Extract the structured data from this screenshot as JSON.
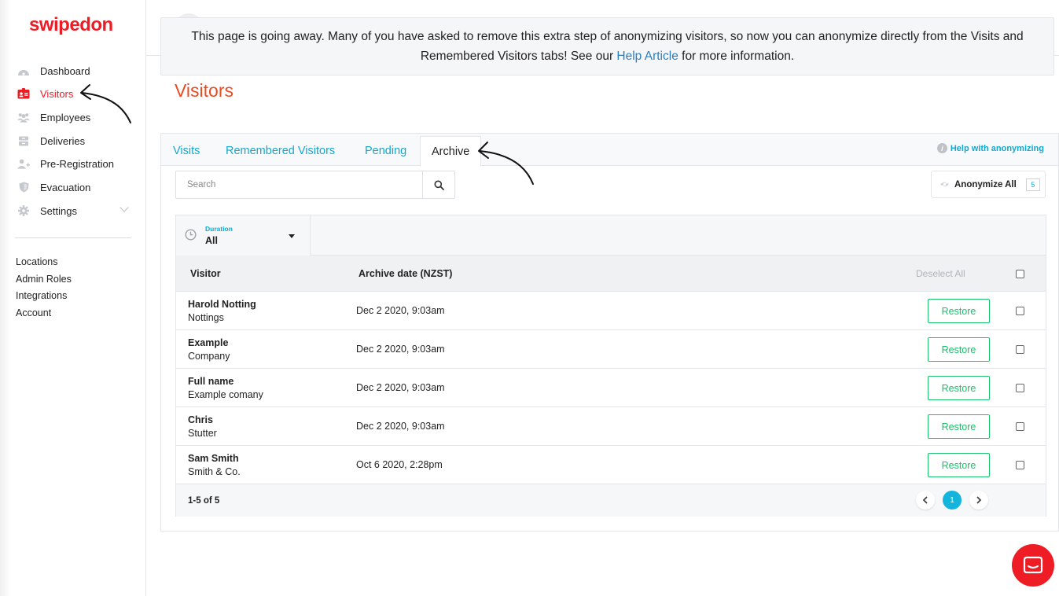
{
  "brand": {
    "logo_text": "swipedon",
    "brand_color": "#ee1c25"
  },
  "sidebar": {
    "items": [
      {
        "label": "Dashboard",
        "icon": "dashboard-icon",
        "active": false
      },
      {
        "label": "Visitors",
        "icon": "visitor-badge-icon",
        "active": true
      },
      {
        "label": "Employees",
        "icon": "employees-icon",
        "active": false
      },
      {
        "label": "Deliveries",
        "icon": "deliveries-icon",
        "active": false
      },
      {
        "label": "Pre-Registration",
        "icon": "pre-registration-icon",
        "active": false
      },
      {
        "label": "Evacuation",
        "icon": "shield-icon",
        "active": false
      },
      {
        "label": "Settings",
        "icon": "gear-icon",
        "active": false
      }
    ],
    "sub_links": [
      "Locations",
      "Admin Roles",
      "Integrations",
      "Account"
    ]
  },
  "notice": {
    "text_before": "This page is going away. Many of you have asked to remove this extra step of anonymizing visitors, so now you can anonymize directly from the Visits and Remembered Visitors tabs! See our ",
    "link_text": "Help Article",
    "text_after": " for more information."
  },
  "page": {
    "title": "Visitors"
  },
  "tabs": [
    {
      "label": "Visits",
      "active": false
    },
    {
      "label": "Remembered Visitors",
      "active": false
    },
    {
      "label": "Pending",
      "active": false
    },
    {
      "label": "Archive",
      "active": true
    }
  ],
  "help_link": "Help with anonymizing",
  "search": {
    "placeholder": "Search",
    "value": ""
  },
  "anonymize": {
    "label": "Anonymize All",
    "count": "5"
  },
  "filter": {
    "label": "Duration",
    "value": "All"
  },
  "table": {
    "columns": {
      "visitor": "Visitor",
      "archive_date": "Archive date (NZST)"
    },
    "deselect_label": "Deselect All",
    "restore_label": "Restore",
    "rows": [
      {
        "name": "Harold Notting",
        "company": "Nottings",
        "date": "Dec 2 2020, 9:03am"
      },
      {
        "name": "Example",
        "company": "Company",
        "date": "Dec 2 2020, 9:03am"
      },
      {
        "name": "Full name",
        "company": "Example comany",
        "date": "Dec 2 2020, 9:03am"
      },
      {
        "name": "Chris",
        "company": "Stutter",
        "date": "Dec 2 2020, 9:03am"
      },
      {
        "name": "Sam Smith",
        "company": "Smith & Co.",
        "date": "Oct 6 2020, 2:28pm"
      }
    ],
    "footer_count": "1-5 of 5",
    "current_page": "1"
  },
  "colors": {
    "accent": "#13a8d0",
    "restore": "#19c26b",
    "title": "#ee4b22"
  }
}
